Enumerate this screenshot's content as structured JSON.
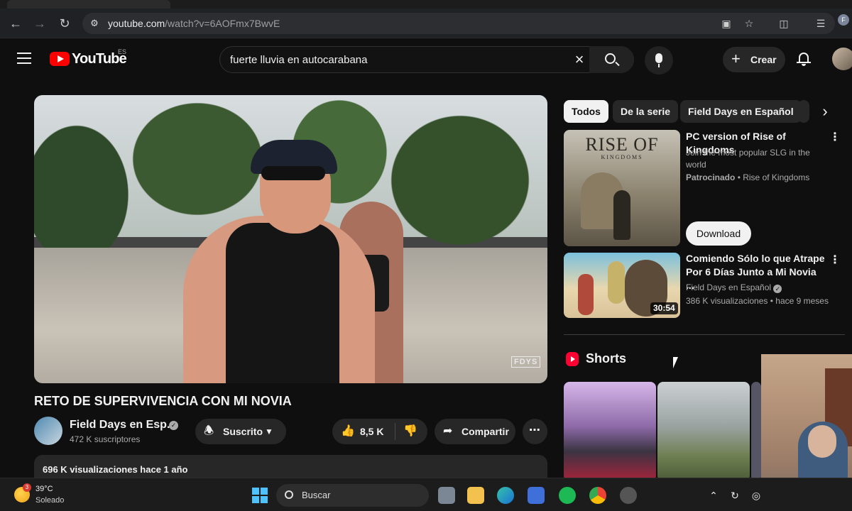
{
  "browser": {
    "url_host": "youtube.com",
    "url_path": "/watch?v=6AOFmx7BwvE",
    "profile_initial": "F"
  },
  "header": {
    "logo_text": "YouTube",
    "region": "ES",
    "search_query": "fuerte lluvia en autocarabana",
    "create_label": "Crear"
  },
  "video": {
    "title": "RETO DE SUPERVIVENCIA CON MI NOVIA",
    "watermark": "FDYS",
    "channel_name": "Field Days en Esp...",
    "subscribers": "472 K suscriptores",
    "subscribe_label": "Suscrito",
    "likes": "8,5 K",
    "share_label": "Compartir",
    "stats": "696 K visualizaciones  hace 1 año"
  },
  "sidebar": {
    "chips": [
      {
        "label": "Todos",
        "active": true
      },
      {
        "label": "De la serie",
        "active": false
      },
      {
        "label": "Field Days en Español",
        "active": false
      }
    ],
    "ad": {
      "thumb_title": "RISE OF",
      "thumb_subtitle": "KINGDOMS",
      "title": "PC version of Rise of Kingdoms",
      "description": "Join the most popular SLG in the world",
      "sponsor_label": "Patrocinado",
      "sponsor_sep": " • Rise of Kingdoms",
      "button_label": "Download"
    },
    "video": {
      "title": "Comiendo Sólo lo que Atrape Por 6 Días Junto a Mi Novia ...",
      "channel": "Field Days en Español",
      "meta": "386 K visualizaciones • hace 9 meses",
      "duration": "30:54"
    },
    "shorts_label": "Shorts"
  },
  "taskbar": {
    "temperature": "39°C",
    "condition": "Soleado",
    "weather_badge": "3",
    "search_label": "Buscar"
  },
  "colors": {
    "background": "#0f0f0f",
    "surface": "#272727",
    "youtube_red": "#ff0000",
    "windows_accent": "#4cc2ff"
  }
}
